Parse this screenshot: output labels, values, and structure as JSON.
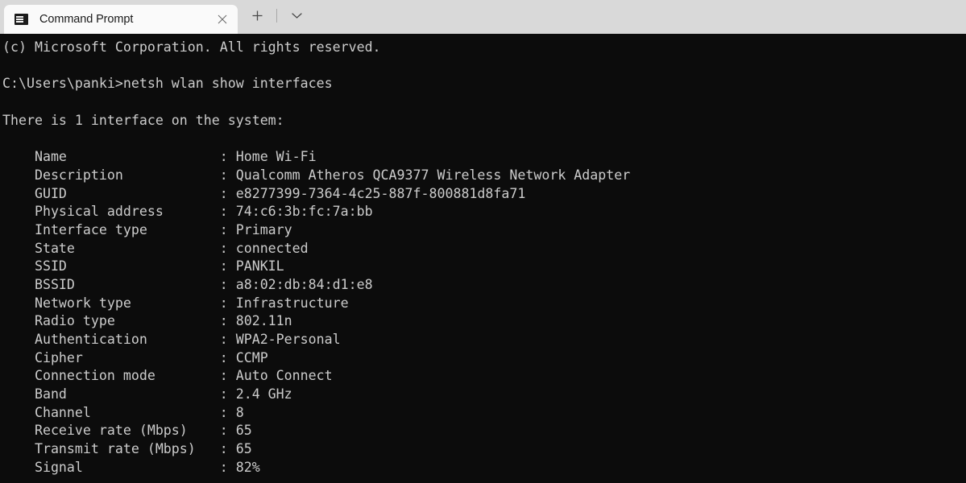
{
  "window": {
    "title": "Command Prompt",
    "colors": {
      "titlebar_bg": "#d9d9d9",
      "active_tab_bg": "#fafafa",
      "terminal_bg": "#0c0c0c",
      "terminal_fg": "#cccccc",
      "tab_title_fg": "#1a1a1a"
    }
  },
  "tabbar": {
    "tabs": [
      {
        "label": "Command Prompt",
        "icon": "console-icon",
        "active": true,
        "close_icon": "close-icon"
      }
    ],
    "new_tab_icon": "plus-icon",
    "dropdown_icon": "chevron-down-icon"
  },
  "terminal": {
    "lines": [
      "(c) Microsoft Corporation. All rights reserved.",
      "",
      "C:\\Users\\panki>netsh wlan show interfaces",
      "",
      "There is 1 interface on the system:",
      "",
      "    Name                   : Home Wi-Fi",
      "    Description            : Qualcomm Atheros QCA9377 Wireless Network Adapter",
      "    GUID                   : e8277399-7364-4c25-887f-800881d8fa71",
      "    Physical address       : 74:c6:3b:fc:7a:bb",
      "    Interface type         : Primary",
      "    State                  : connected",
      "    SSID                   : PANKIL",
      "    BSSID                  : a8:02:db:84:d1:e8",
      "    Network type           : Infrastructure",
      "    Radio type             : 802.11n",
      "    Authentication         : WPA2-Personal",
      "    Cipher                 : CCMP",
      "    Connection mode        : Auto Connect",
      "    Band                   : 2.4 GHz",
      "    Channel                : 8",
      "    Receive rate (Mbps)    : 65",
      "    Transmit rate (Mbps)   : 65",
      "    Signal                 : 82%"
    ],
    "command": "netsh wlan show interfaces",
    "prompt": "C:\\Users\\panki>",
    "interface_count": "1",
    "fields": [
      {
        "key": "Name",
        "value": "Home Wi-Fi"
      },
      {
        "key": "Description",
        "value": "Qualcomm Atheros QCA9377 Wireless Network Adapter"
      },
      {
        "key": "GUID",
        "value": "e8277399-7364-4c25-887f-800881d8fa71"
      },
      {
        "key": "Physical address",
        "value": "74:c6:3b:fc:7a:bb"
      },
      {
        "key": "Interface type",
        "value": "Primary"
      },
      {
        "key": "State",
        "value": "connected"
      },
      {
        "key": "SSID",
        "value": "PANKIL"
      },
      {
        "key": "BSSID",
        "value": "a8:02:db:84:d1:e8"
      },
      {
        "key": "Network type",
        "value": "Infrastructure"
      },
      {
        "key": "Radio type",
        "value": "802.11n"
      },
      {
        "key": "Authentication",
        "value": "WPA2-Personal"
      },
      {
        "key": "Cipher",
        "value": "CCMP"
      },
      {
        "key": "Connection mode",
        "value": "Auto Connect"
      },
      {
        "key": "Band",
        "value": "2.4 GHz"
      },
      {
        "key": "Channel",
        "value": "8"
      },
      {
        "key": "Receive rate (Mbps)",
        "value": "65"
      },
      {
        "key": "Transmit rate (Mbps)",
        "value": "65"
      },
      {
        "key": "Signal",
        "value": "82%"
      }
    ]
  }
}
